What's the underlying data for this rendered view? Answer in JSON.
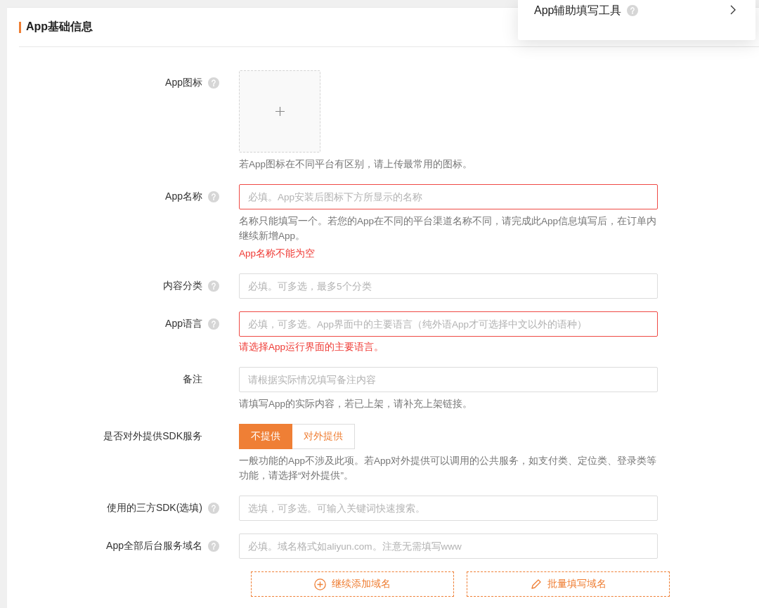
{
  "section": {
    "title": "App基础信息"
  },
  "popover": {
    "title": "App辅助填写工具",
    "help": true
  },
  "fields": [
    {
      "kind": "upload",
      "label": "App图标",
      "help": true,
      "hint": "若App图标在不同平台有区别，请上传最常用的图标。"
    },
    {
      "kind": "input",
      "label": "App名称",
      "help": true,
      "placeholder": "必填。App安装后图标下方所显示的名称",
      "invalid": true,
      "hint": "名称只能填写一个。若您的App在不同的平台渠道名称不同，请完成此App信息填写后，在订单内继续新增App。",
      "error": "App名称不能为空"
    },
    {
      "kind": "input",
      "label": "内容分类",
      "help": true,
      "placeholder": "必填。可多选，最多5个分类",
      "invalid": false
    },
    {
      "kind": "input",
      "label": "App语言",
      "help": true,
      "placeholder": "必填，可多选。App界面中的主要语言（纯外语App才可选择中文以外的语种）",
      "invalid": true,
      "error": "请选择App运行界面的主要语言。"
    },
    {
      "kind": "input",
      "label": "备注",
      "help": false,
      "placeholder": "请根据实际情况填写备注内容",
      "invalid": false,
      "hint": "请填写App的实际内容，若已上架，请补充上架链接。"
    },
    {
      "kind": "segmented",
      "label": "是否对外提供SDK服务",
      "help": false,
      "options": [
        {
          "label": "不提供",
          "selected": true
        },
        {
          "label": "对外提供",
          "selected": false
        }
      ],
      "hint": "一般功能的App不涉及此项。若App对外提供可以调用的公共服务，如支付类、定位类、登录类等功能，请选择“对外提供”。"
    },
    {
      "kind": "input",
      "label": "使用的三方SDK(选填)",
      "help": true,
      "placeholder": "选填，可多选。可输入关键词快速搜索。",
      "invalid": false
    },
    {
      "kind": "input",
      "label": "App全部后台服务域名",
      "help": true,
      "placeholder": "必填。域名格式如aliyun.com。注意无需填写www",
      "invalid": false
    }
  ],
  "domain_buttons": [
    {
      "kind": "add",
      "label": "继续添加域名"
    },
    {
      "kind": "batch",
      "label": "批量填写域名"
    }
  ]
}
